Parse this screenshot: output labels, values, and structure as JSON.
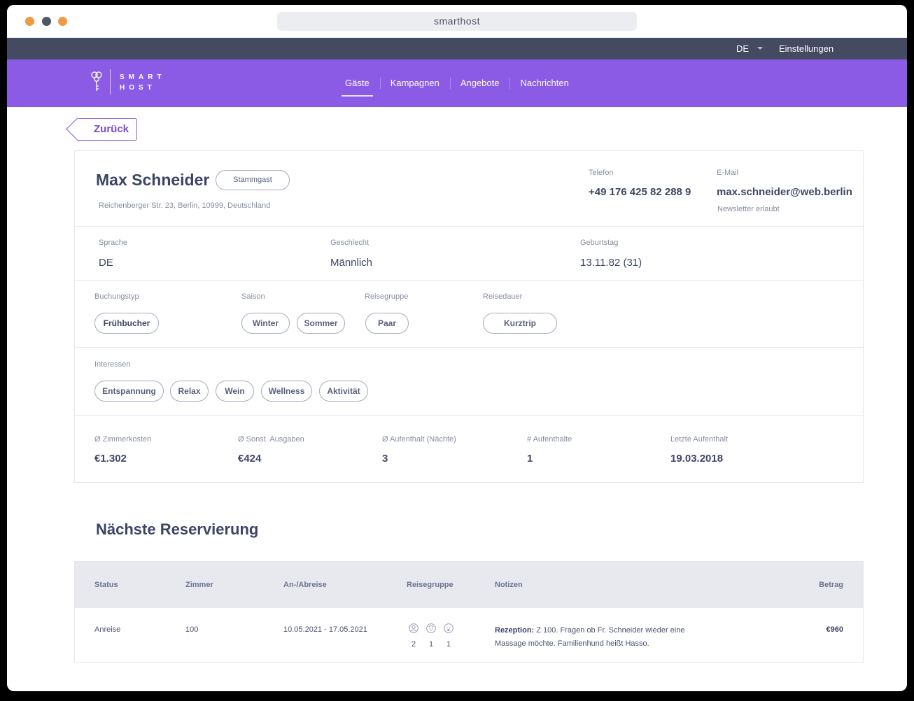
{
  "window": {
    "url": "smarthost",
    "dot_colors": [
      "#f29a3e",
      "#4f5767",
      "#f29a3e"
    ]
  },
  "colors": {
    "topbar": "#434a62",
    "navbar": "#8b5be6",
    "accent": "#7a49da",
    "text_dark": "#3c4566",
    "text_muted": "#878da2"
  },
  "topbar": {
    "language": "DE",
    "settings": "Einstellungen"
  },
  "navbar": {
    "logo_line1": "SMART",
    "logo_line2": "HOST",
    "items": [
      {
        "label": "Gäste",
        "active": true
      },
      {
        "label": "Kampagnen",
        "active": false
      },
      {
        "label": "Angebote",
        "active": false
      },
      {
        "label": "Nachrichten",
        "active": false
      }
    ]
  },
  "back_label": "Zurück",
  "guest": {
    "name": "Max Schneider",
    "badge": "Stammgast",
    "address": "Reichenberger Str. 23, Berlin, 10999, Deutschland",
    "phone_label": "Telefon",
    "phone": "+49 176 425 82 288 9",
    "email_label": "E-Mail",
    "email": "max.schneider@web.berlin",
    "newsletter": "Newsletter erlaubt",
    "language_label": "Sprache",
    "language": "DE",
    "gender_label": "Geschlecht",
    "gender": "Männlich",
    "birthday_label": "Geburtstag",
    "birthday": "13.11.82 (31)"
  },
  "segments": {
    "booking_type_label": "Buchungstyp",
    "booking_type": [
      "Frühbucher"
    ],
    "season_label": "Saison",
    "season": [
      "Winter",
      "Sommer"
    ],
    "travel_group_label": "Reisegruppe",
    "travel_group": [
      "Paar"
    ],
    "duration_label": "Reisedauer",
    "duration": [
      "Kurztrip"
    ],
    "interests_label": "Interessen",
    "interests": [
      "Entspannung",
      "Relax",
      "Wein",
      "Wellness",
      "Aktivität"
    ]
  },
  "stats": [
    {
      "label": "Ø Zimmerkosten",
      "value": "€1.302"
    },
    {
      "label": "Ø Sonst. Ausgaben",
      "value": "€424"
    },
    {
      "label": "Ø Aufenthalt (Nächte)",
      "value": "3"
    },
    {
      "label": "# Aufenthalte",
      "value": "1"
    },
    {
      "label": "Letzte Aufenthalt",
      "value": "19.03.2018"
    }
  ],
  "reservation": {
    "title": "Nächste Reservierung",
    "columns": [
      "Status",
      "Zimmer",
      "An-/Abreise",
      "Reisegruppe",
      "Notizen",
      "Betrag"
    ],
    "row": {
      "status": "Anreise",
      "room": "100",
      "dates": "10.05.2021 - 17.05.2021",
      "group_icons": [
        "adult-icon",
        "child-icon",
        "baby-icon"
      ],
      "group_counts": [
        "2",
        "1",
        "1"
      ],
      "notes_prefix": "Rezeption:",
      "notes": " Z 100. Fragen ob Fr. Schneider wieder eine Massage möchte. Familienhund heißt Hasso.",
      "amount": "€960"
    }
  }
}
